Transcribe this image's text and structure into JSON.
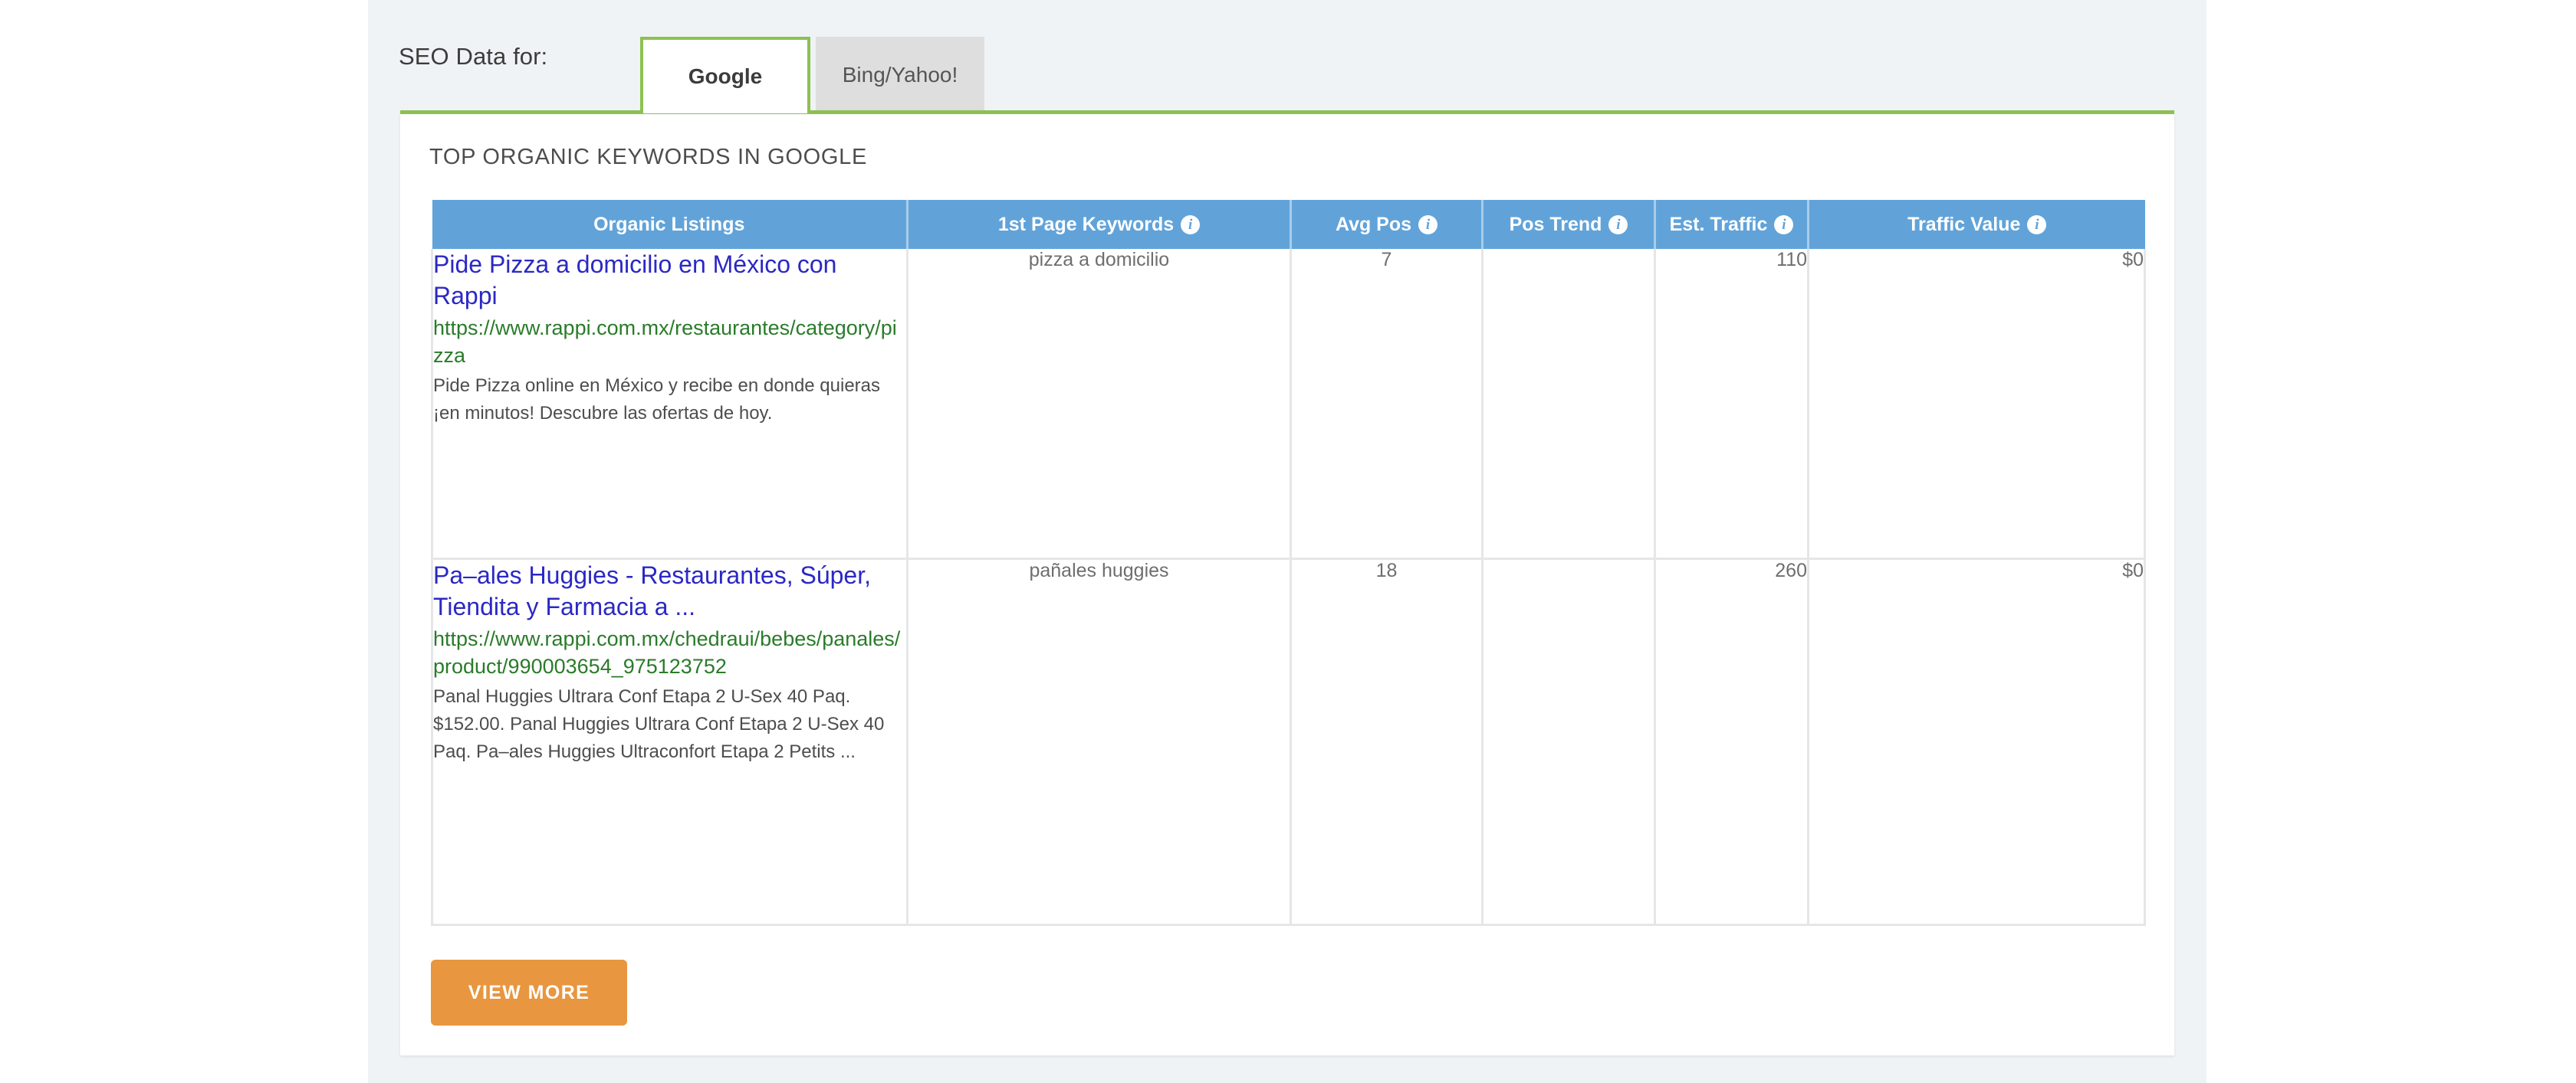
{
  "header": {
    "seo_label": "SEO Data for:",
    "tabs": [
      {
        "id": "google",
        "label": "Google",
        "active": true
      },
      {
        "id": "bing-yahoo",
        "label": "Bing/Yahoo!",
        "active": false
      }
    ]
  },
  "card": {
    "section_title": "TOP ORGANIC KEYWORDS IN GOOGLE",
    "view_more_label": "VIEW MORE"
  },
  "table": {
    "columns": [
      {
        "key": "organic_listings",
        "label": "Organic Listings",
        "info": false
      },
      {
        "key": "first_page_keywords",
        "label": "1st Page Keywords",
        "info": true
      },
      {
        "key": "avg_pos",
        "label": "Avg Pos",
        "info": true
      },
      {
        "key": "pos_trend",
        "label": "Pos Trend",
        "info": true
      },
      {
        "key": "est_traffic",
        "label": "Est. Traffic",
        "info": true
      },
      {
        "key": "traffic_value",
        "label": "Traffic Value",
        "info": true
      }
    ],
    "info_icon_glyph": "i",
    "rows": [
      {
        "title": "Pide Pizza a domicilio en México con Rappi",
        "url": "https://www.rappi.com.mx/restaurantes/category/pizza",
        "description": "Pide Pizza online en México y recibe en donde quieras ¡en minutos! Descubre las ofertas de hoy.",
        "first_page_keywords": "pizza a domicilio",
        "avg_pos": "7",
        "pos_trend": "",
        "est_traffic": "110",
        "traffic_value": "$0"
      },
      {
        "title": "Pa–ales Huggies - Restaurantes, Súper, Tiendita y Farmacia a ...",
        "url": "https://www.rappi.com.mx/chedraui/bebes/panales/product/990003654_975123752",
        "description": "Panal Huggies Ultrara Conf Etapa 2 U-Sex 40 Paq. $152.00. Panal Huggies Ultrara Conf Etapa 2 U-Sex 40 Paq. Pa–ales Huggies Ultraconfort Etapa 2 Petits ...",
        "first_page_keywords": "pañales huggies",
        "avg_pos": "18",
        "pos_trend": "",
        "est_traffic": "260",
        "traffic_value": "$0"
      }
    ]
  },
  "colors": {
    "accent_green": "#8cc152",
    "header_blue": "#61a3d9",
    "button_orange": "#e8963f",
    "link_blue": "#2b28c4",
    "url_green": "#2a7b2a",
    "page_bg": "#f0f3f5"
  }
}
